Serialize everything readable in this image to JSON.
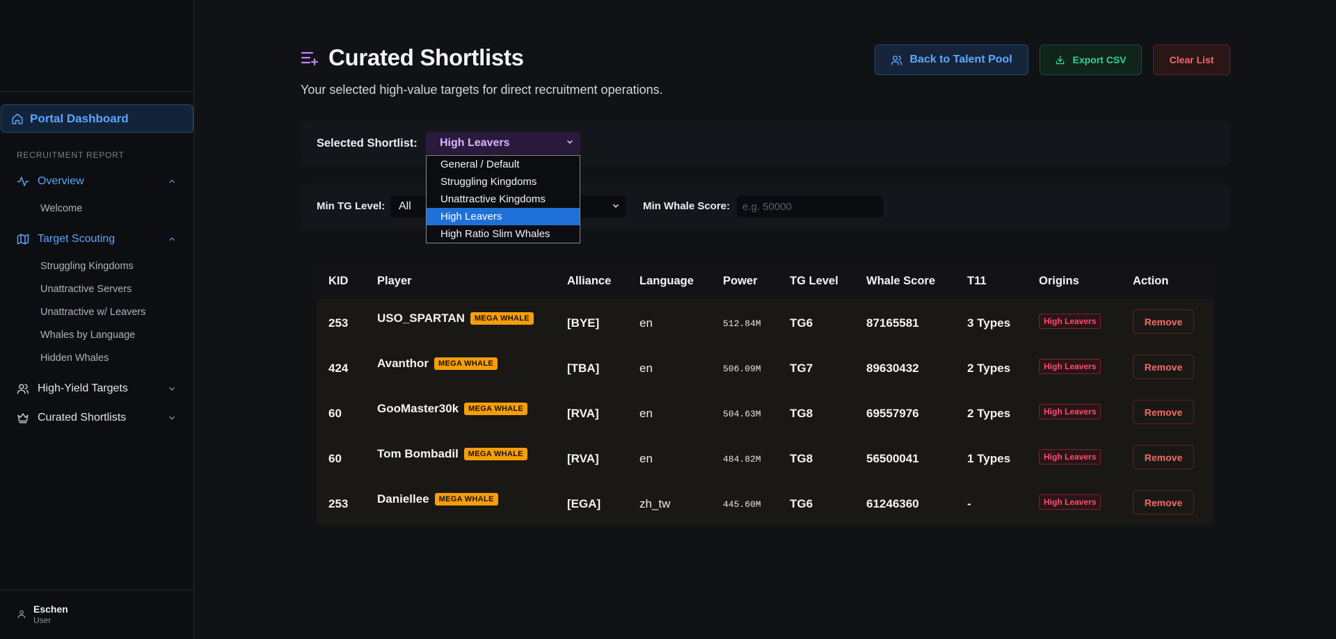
{
  "sidebar": {
    "dashboard": "Portal Dashboard",
    "section_label": "RECRUITMENT REPORT",
    "overview": "Overview",
    "welcome": "Welcome",
    "target_scouting": "Target Scouting",
    "scouting_items": [
      "Struggling Kingdoms",
      "Unattractive Servers",
      "Unattractive w/ Leavers",
      "Whales by Language",
      "Hidden Whales"
    ],
    "high_yield": "High-Yield Targets",
    "curated": "Curated Shortlists",
    "user": {
      "name": "Eschen",
      "role": "User"
    }
  },
  "header": {
    "title": "Curated Shortlists",
    "subtitle": "Your selected high-value targets for direct recruitment operations.",
    "back_label": "Back to Talent Pool",
    "export_label": "Export CSV",
    "clear_label": "Clear List"
  },
  "shortlist": {
    "label": "Selected Shortlist:",
    "selected": "High Leavers",
    "options": [
      "General / Default",
      "Struggling Kingdoms",
      "Unattractive Kingdoms",
      "High Leavers",
      "High Ratio Slim Whales"
    ]
  },
  "filters": {
    "tg_label": "Min TG Level:",
    "tg_value": "All",
    "whale_label": "Min Whale Score:",
    "whale_placeholder": "e.g. 50000"
  },
  "table": {
    "columns": [
      "KID",
      "Player",
      "Alliance",
      "Language",
      "Power",
      "TG Level",
      "Whale Score",
      "T11",
      "Origins",
      "Action"
    ],
    "rows": [
      {
        "kid": "253",
        "player": "USO_SPARTAN",
        "badge": "MEGA WHALE",
        "alliance": "[BYE]",
        "language": "en",
        "power": "512.84M",
        "tg": "TG6",
        "whale": "87165581",
        "t11": "3 Types",
        "origin": "High Leavers",
        "action": "Remove"
      },
      {
        "kid": "424",
        "player": "Avanthor",
        "badge": "MEGA WHALE",
        "alliance": "[TBA]",
        "language": "en",
        "power": "506.09M",
        "tg": "TG7",
        "whale": "89630432",
        "t11": "2 Types",
        "origin": "High Leavers",
        "action": "Remove"
      },
      {
        "kid": "60",
        "player": "GooMaster30k",
        "badge": "MEGA WHALE",
        "alliance": "[RVA]",
        "language": "en",
        "power": "504.63M",
        "tg": "TG8",
        "whale": "69557976",
        "t11": "2 Types",
        "origin": "High Leavers",
        "action": "Remove"
      },
      {
        "kid": "60",
        "player": "Tom Bombadil",
        "badge": "MEGA WHALE",
        "alliance": "[RVA]",
        "language": "en",
        "power": "484.82M",
        "tg": "TG8",
        "whale": "56500041",
        "t11": "1 Types",
        "origin": "High Leavers",
        "action": "Remove"
      },
      {
        "kid": "253",
        "player": "Daniellee",
        "badge": "MEGA WHALE",
        "alliance": "[EGA]",
        "language": "zh_tw",
        "power": "445.60M",
        "tg": "TG6",
        "whale": "61246360",
        "t11": "-",
        "origin": "High Leavers",
        "action": "Remove"
      }
    ]
  },
  "colors": {
    "accent_blue": "#5aa6ff",
    "accent_purple": "#c084fc",
    "export_green": "#34d399",
    "danger_red": "#f26b6b",
    "whale_badge": "#f59e0b",
    "dropdown_highlight": "#1f6fd8"
  }
}
